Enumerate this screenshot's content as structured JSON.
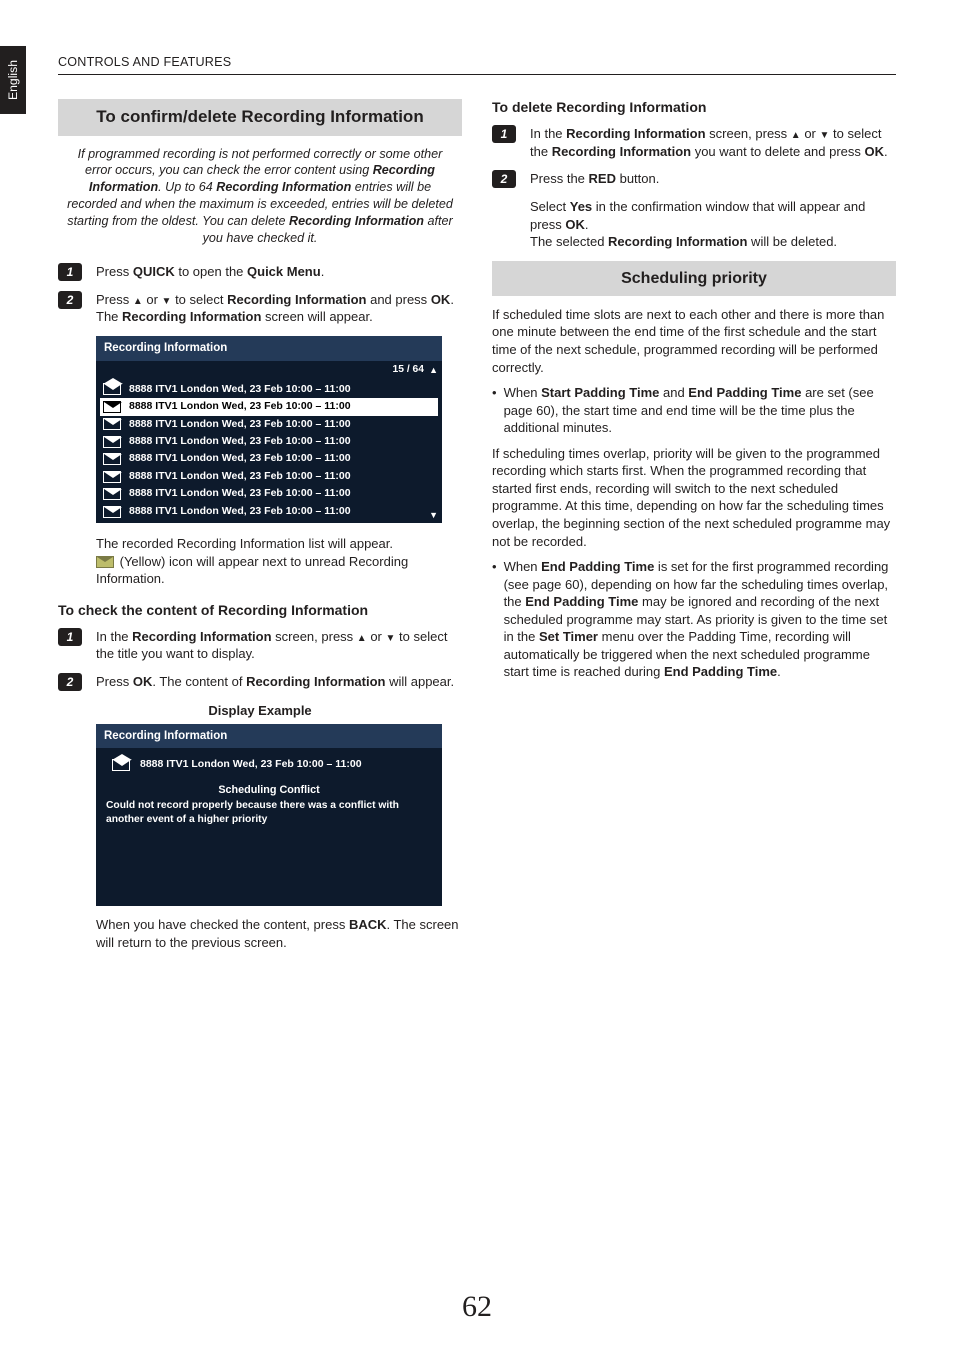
{
  "header": "CONTROLS AND FEATURES",
  "lang_tab": "English",
  "page_number": "62",
  "left": {
    "title": "To confirm/delete Recording Information",
    "intro_parts": {
      "a": "If programmed recording is not performed correctly or some other error occurs, you can check the error content using ",
      "b": "Recording Information",
      "c": ". Up to 64 ",
      "d": "Recording Information",
      "e": " entries will be recorded and when the maximum is exceeded, entries will be deleted starting from the oldest. You can delete ",
      "f": "Recording Information",
      "g": " after you have checked it."
    },
    "step1": {
      "a": "Press ",
      "b": "QUICK",
      "c": " to open the ",
      "d": "Quick Menu",
      "e": "."
    },
    "step2": {
      "a": "Press ",
      "b": " or ",
      "c": " to select ",
      "d": "Recording Information",
      "e": " and press ",
      "f": "OK",
      "g": ". The ",
      "h": "Recording Information",
      "i": " screen will appear."
    },
    "list": {
      "title": "Recording Information",
      "count": "15 / 64",
      "rows": [
        "8888 ITV1 London  Wed, 23 Feb  10:00 – 11:00",
        "8888 ITV1 London  Wed, 23 Feb  10:00 – 11:00",
        "8888 ITV1 London  Wed, 23 Feb  10:00 – 11:00",
        "8888 ITV1 London  Wed, 23 Feb  10:00 – 11:00",
        "8888 ITV1 London  Wed, 23 Feb  10:00 – 11:00",
        "8888 ITV1 London  Wed, 23 Feb  10:00 – 11:00",
        "8888 ITV1 London  Wed, 23 Feb  10:00 – 11:00",
        "8888 ITV1 London  Wed, 23 Feb  10:00 – 11:00"
      ],
      "highlight_index": 1
    },
    "after_list": {
      "a": "The recorded Recording Information list will appear.",
      "b": " (Yellow) icon will appear next to unread Recording Information."
    },
    "check_title": "To check the content of Recording Information",
    "check_step1": {
      "a": "In the ",
      "b": "Recording Information",
      "c": " screen, press ",
      "d": " or ",
      "e": " to select the title you want to display."
    },
    "check_step2": {
      "a": "Press ",
      "b": "OK",
      "c": ". The content of ",
      "d": "Recording Information",
      "e": " will appear."
    },
    "display_example": "Display Example",
    "detail": {
      "title": "Recording Information",
      "line": "8888 ITV1 London  Wed, 23 Feb  10:00 – 11:00",
      "conflict_title": "Scheduling Conflict",
      "conflict_body": "Could not record properly because there was a conflict with another event of a higher priority"
    },
    "after_detail": {
      "a": "When you have checked the content, press ",
      "b": "BACK",
      "c": ". The screen will return to the previous screen."
    }
  },
  "right": {
    "delete_title": "To delete Recording Information",
    "del_step1": {
      "a": "In the ",
      "b": "Recording Information",
      "c": " screen, press ",
      "d": " or ",
      "e": " to select the ",
      "f": "Recording Information",
      "g": " you want to delete and press ",
      "h": "OK",
      "i": "."
    },
    "del_step2": {
      "a": "Press the ",
      "b": "RED",
      "c": " button."
    },
    "del_after": {
      "a": "Select ",
      "b": "Yes",
      "c": " in the confirmation window that will appear and press ",
      "d": "OK",
      "e": ".",
      "f": "The selected ",
      "g": "Recording Information",
      "h": " will be deleted."
    },
    "prio_title": "Scheduling priority",
    "prio_p1": "If scheduled time slots are next to each other and there is more than one minute between the end time of the first schedule and the start time of the next schedule, programmed recording will be performed correctly.",
    "prio_b1": {
      "a": "When ",
      "b": "Start Padding Time",
      "c": " and ",
      "d": "End Padding Time",
      "e": " are set (see page 60), the start time and end time will be the time plus the additional minutes."
    },
    "prio_p2": "If scheduling times overlap, priority will be given to the programmed recording which starts first. When the programmed recording that started first ends, recording will switch to the next scheduled programme. At this time, depending on how far the scheduling times overlap, the beginning section of the next scheduled programme may not be recorded.",
    "prio_b2": {
      "a": "When ",
      "b": "End Padding Time",
      "c": " is set for the first programmed recording (see page 60), depending on how far the scheduling times overlap, the ",
      "d": "End Padding Time",
      "e": " may be ignored and recording of the next scheduled programme may start. As priority is given to the time set in the ",
      "f": "Set Timer",
      "g": " menu over the Padding Time, recording will automatically be triggered when the next scheduled programme start time is reached during ",
      "h": "End Padding Time",
      "i": "."
    }
  }
}
